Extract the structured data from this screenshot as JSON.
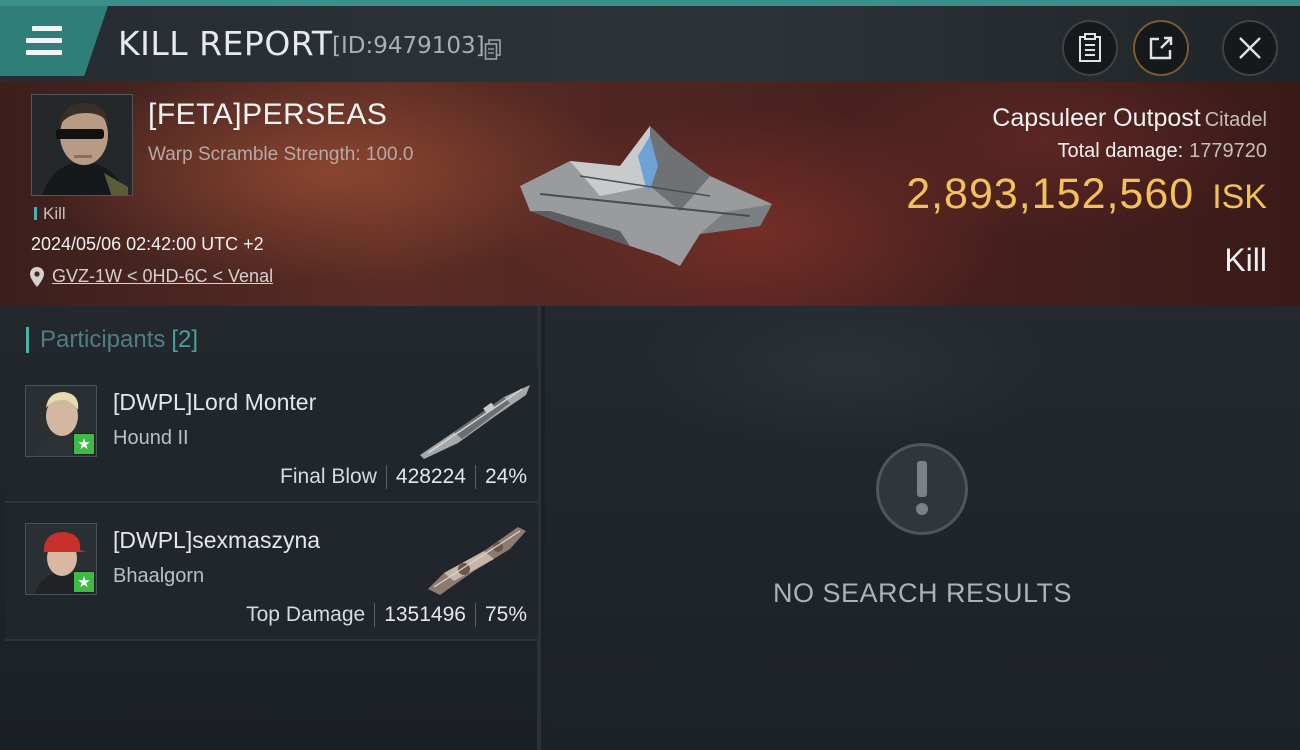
{
  "header": {
    "title": "KILL REPORT",
    "report_id": "[ID:9479103]",
    "icons": {
      "menu": "hamburger-menu-icon",
      "copy": "copy-icon",
      "log": "clipboard-icon",
      "share": "share-icon",
      "close": "close-icon"
    }
  },
  "victim": {
    "name": "[FETA]PERSEAS",
    "warp_scramble": "Warp Scramble Strength: 100.0",
    "tag": "Kill",
    "datetime": "2024/05/06 02:42:00 UTC +2",
    "location": "GVZ-1W < 0HD-6C < Venal",
    "target_name": "Capsuleer Outpost",
    "target_category": "Citadel",
    "total_damage_label": "Total damage:",
    "total_damage": "1779720",
    "isk_value": "2,893,152,560",
    "isk_unit": "ISK",
    "outcome": "Kill"
  },
  "participants": {
    "label": "Participants",
    "count": "[2]",
    "items": [
      {
        "name": "[DWPL]Lord Monter",
        "ship": "Hound II",
        "role": "Final Blow",
        "damage": "428224",
        "percent": "24%"
      },
      {
        "name": "[DWPL]sexmaszyna",
        "ship": "Bhaalgorn",
        "role": "Top Damage",
        "damage": "1351496",
        "percent": "75%"
      }
    ]
  },
  "detail_panel": {
    "empty_text": "NO SEARCH RESULTS"
  },
  "colors": {
    "accent": "#3a8f8a",
    "isk": "#f3c15c",
    "star": "#3dbb45"
  }
}
